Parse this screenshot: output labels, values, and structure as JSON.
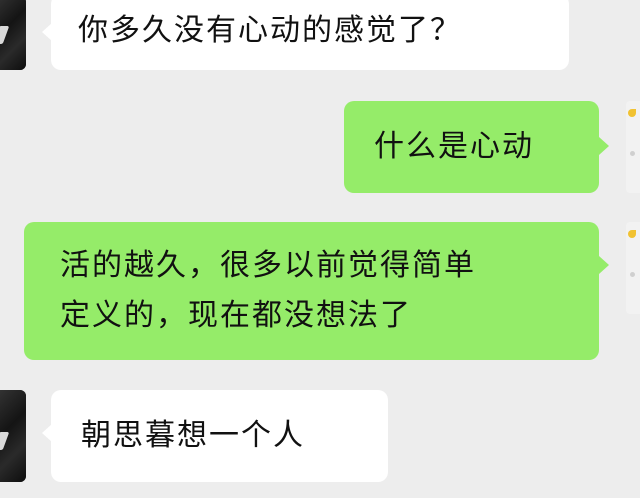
{
  "chat": {
    "messages": [
      {
        "side": "left",
        "text": "你多久没有心动的感觉了？"
      },
      {
        "side": "right",
        "text": "什么是心动"
      },
      {
        "side": "right",
        "lines": [
          "活的越久，很多以前觉得简单",
          "定义的，现在都没想法了"
        ]
      },
      {
        "side": "left",
        "text": "朝思暮想一个人"
      }
    ]
  },
  "icons": {
    "other_avatar": "dark-profile-avatar",
    "self_avatar": "light-profile-avatar-with-sparkle"
  },
  "colors": {
    "background": "#ededed",
    "incoming_bubble": "#ffffff",
    "outgoing_bubble": "#95ec69",
    "text": "#111111"
  }
}
